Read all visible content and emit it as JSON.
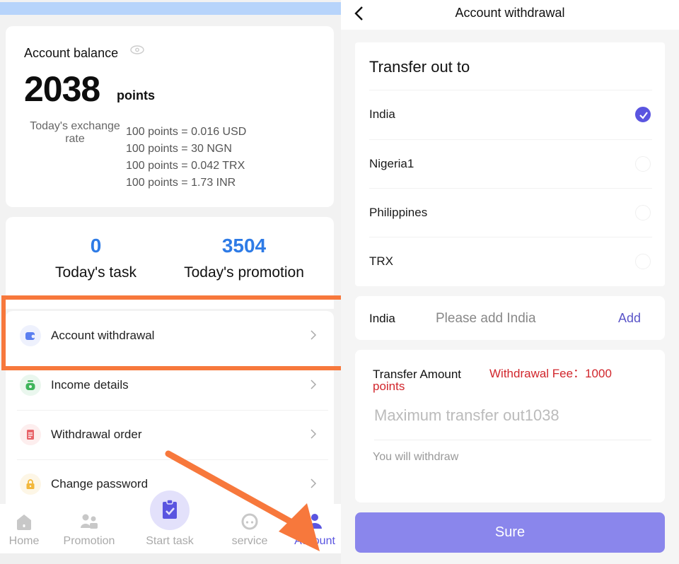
{
  "account_screen": {
    "balance": {
      "label": "Account balance",
      "visibility_icon": "eye-icon",
      "value": "2038",
      "unit": "points",
      "exchange_rate_label": "Today's exchange rate",
      "rates": [
        "100 points = 0.016 USD",
        "100 points = 30 NGN",
        "100 points = 0.042 TRX",
        "100 points = 1.73 INR"
      ]
    },
    "stats": [
      {
        "value": "0",
        "label": "Today's task"
      },
      {
        "value": "3504",
        "label": "Today's promotion"
      }
    ],
    "menu": [
      {
        "label": "Account withdrawal",
        "icon": "wallet-icon",
        "color": "#5b7ff0",
        "bg": "#eef1fd"
      },
      {
        "label": "Income details",
        "icon": "money-bag-icon",
        "color": "#3fb55b",
        "bg": "#eaf7ee"
      },
      {
        "label": "Withdrawal order",
        "icon": "document-icon",
        "color": "#e8646a",
        "bg": "#fdeeee"
      },
      {
        "label": "Change password",
        "icon": "lock-icon",
        "color": "#f2b73a",
        "bg": "#fdf6e6"
      }
    ],
    "tabs": [
      {
        "label": "Home",
        "icon": "home-icon",
        "active": false
      },
      {
        "label": "Promotion",
        "icon": "people-icon",
        "active": false
      },
      {
        "label": "Start task",
        "icon": "clipboard-check-icon",
        "active": false
      },
      {
        "label": "service",
        "icon": "headset-icon",
        "active": false
      },
      {
        "label": "Account",
        "icon": "user-icon",
        "active": true
      }
    ],
    "colors": {
      "accent": "#5a55e0",
      "stat_blue": "#2e7be6",
      "annotation_orange": "#f7783c"
    }
  },
  "withdrawal_screen": {
    "title": "Account withdrawal",
    "transfer_title": "Transfer out to",
    "options": [
      {
        "label": "India",
        "selected": true
      },
      {
        "label": "Nigeria1",
        "selected": false
      },
      {
        "label": "Philippines",
        "selected": false
      },
      {
        "label": "TRX",
        "selected": false
      }
    ],
    "account": {
      "label": "India",
      "placeholder": "Please add India",
      "add_label": "Add"
    },
    "amount": {
      "label": "Transfer Amount",
      "fee_text": "Withdrawal Fee：1000 points",
      "placeholder": "Maximum transfer out1038",
      "will_withdraw": "You will withdraw"
    },
    "submit_label": "Sure",
    "colors": {
      "accent": "#5a55e0",
      "button": "#8a86ec",
      "fee_red": "#d1262c"
    }
  }
}
